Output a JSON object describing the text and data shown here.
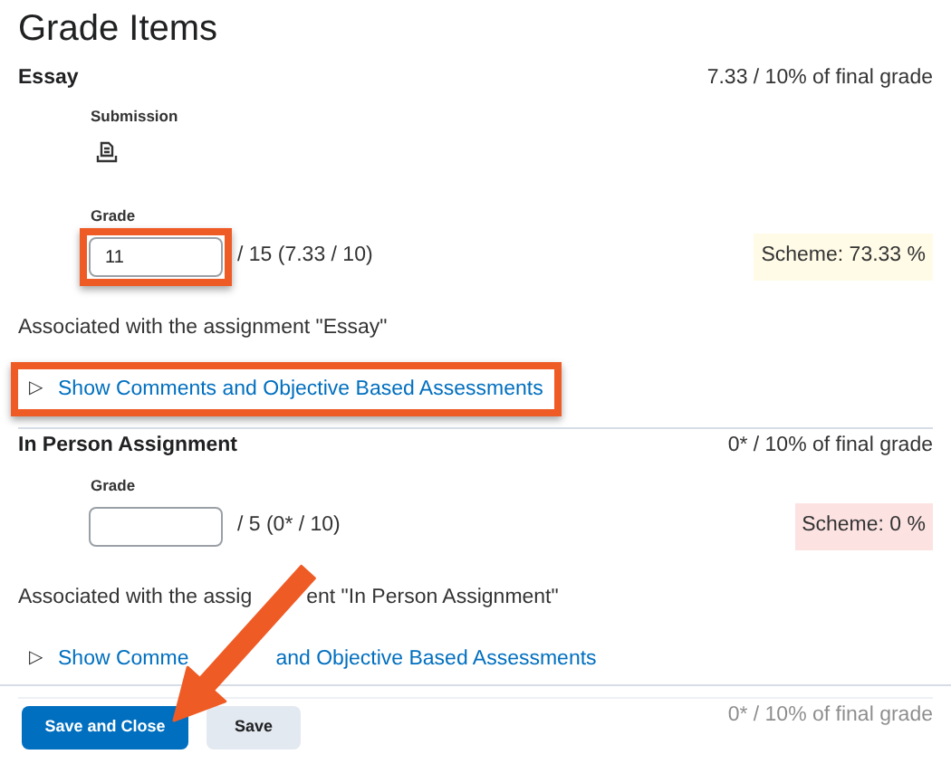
{
  "title": "Grade Items",
  "items": [
    {
      "name": "Essay",
      "weight": "7.33 / 10% of final grade",
      "submission_label": "Submission",
      "grade_label": "Grade",
      "grade": {
        "value": "11"
      },
      "out_of": "/ 15 (7.33 / 10)",
      "scheme": "Scheme: 73.33 %",
      "color": "#fffbe6",
      "highlighted_input": true,
      "association": [
        "Associated with the assignment \"Essay\""
      ],
      "toggle_icon": "▷",
      "toggle": [
        "Show Comments and Objective Based Assessments"
      ],
      "highlighted_toggle": true
    },
    {
      "name": "In Person Assignment",
      "weight": "0* / 10% of final grade",
      "grade_label": "Grade",
      "out_of": "/ 5 (0* / 10)",
      "scheme": "Scheme: 0 %",
      "color": "#fde2e2",
      "highlighted_input": false,
      "association": [
        "Associated with the assig",
        "ent \"In Person Assignment\""
      ],
      "toggle_icon": "▷",
      "toggle": [
        "Show Comme",
        "and Objective Based Assessments"
      ],
      "highlighted_toggle": false
    }
  ],
  "faded_item": {
    "weight": "0* / 10% of final grade"
  },
  "buttons": [
    {
      "label": "Save and Close",
      "kind": "primary"
    },
    {
      "label": "Save",
      "kind": "secondary"
    }
  ]
}
